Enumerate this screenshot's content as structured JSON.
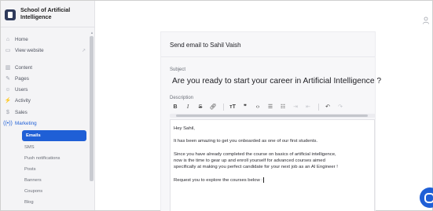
{
  "brand": {
    "name": "School of Artificial Intelligence"
  },
  "sidebar": {
    "items": [
      {
        "label": "Home",
        "icon": "home-icon"
      },
      {
        "label": "View website",
        "icon": "monitor-icon",
        "trailing_icon": "external-link-icon"
      },
      {
        "label": "Content",
        "icon": "columns-icon"
      },
      {
        "label": "Pages",
        "icon": "edit-icon"
      },
      {
        "label": "Users",
        "icon": "users-icon"
      },
      {
        "label": "Activity",
        "icon": "activity-icon"
      },
      {
        "label": "Sales",
        "icon": "dollar-icon"
      },
      {
        "label": "Marketing",
        "icon": "broadcast-icon"
      }
    ],
    "marketing_sub": [
      {
        "label": "Emails",
        "active": true
      },
      {
        "label": "SMS",
        "active": false
      },
      {
        "label": "Push notifications",
        "active": false
      },
      {
        "label": "Posts",
        "active": false
      },
      {
        "label": "Banners",
        "active": false
      },
      {
        "label": "Coupons",
        "active": false
      },
      {
        "label": "Blog",
        "active": false
      }
    ]
  },
  "panel": {
    "title": "Send email to Sahil Vaish",
    "subject_label": "Subject",
    "subject_value": "Are you ready to start your career in Artificial Intelligence ?",
    "description_label": "Description",
    "toolbar": [
      "B",
      "I",
      "S",
      "link",
      "heading",
      "quote",
      "code",
      "bulleted-list",
      "numbered-list",
      "indent",
      "outdent",
      "undo",
      "redo"
    ]
  },
  "editor": {
    "lines": [
      "Hey Sahil,",
      "It has been amazing to get you onboarded as one of our first students.",
      "Since you have already completed the course on basics of artificial intelligence,",
      "now is the time to gear up and enroll yourself for advanced courses aimed",
      "specifically at making you perfect candidate for your next job as an AI Engineer !",
      "Request you to explore the courses below :"
    ]
  },
  "colors": {
    "accent": "#1f5fd6",
    "brand_logo": "#2f3b5c"
  }
}
